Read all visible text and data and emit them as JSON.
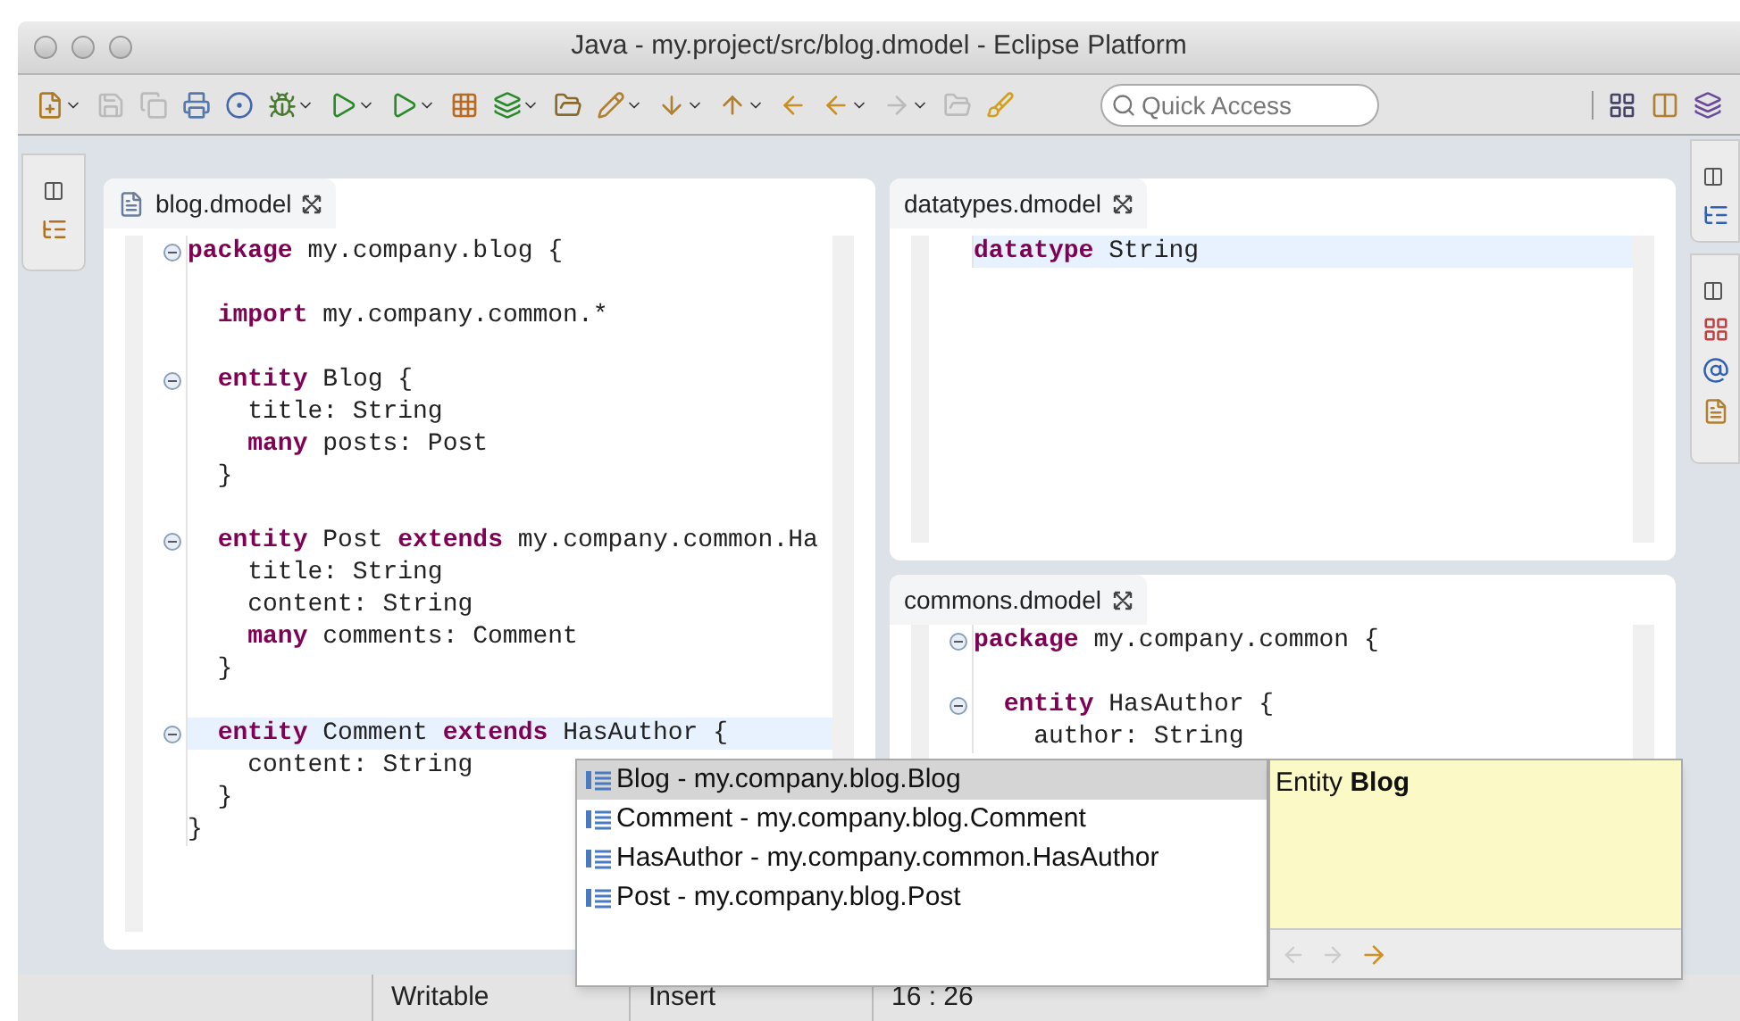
{
  "window": {
    "title": "Java - my.project/src/blog.dmodel - Eclipse Platform"
  },
  "quick_access": {
    "placeholder": "Quick Access"
  },
  "editors": [
    {
      "tab": "blog.dmodel",
      "file_icon": true,
      "lines": [
        {
          "fold": true,
          "highlighted": false,
          "code": "**package** my.company.blog {"
        },
        {
          "fold": false,
          "highlighted": false
        },
        {
          "fold": false,
          "highlighted": false,
          "code": "  **import** my.company.common.*"
        },
        {
          "fold": false,
          "highlighted": false
        },
        {
          "fold": true,
          "highlighted": false,
          "code": "  **entity** Blog {"
        },
        {
          "fold": false,
          "highlighted": false,
          "code": "    title: String"
        },
        {
          "fold": false,
          "highlighted": false,
          "code": "    **many** posts: Post"
        },
        {
          "fold": false,
          "highlighted": false,
          "code": "  }"
        },
        {
          "fold": false,
          "highlighted": false
        },
        {
          "fold": true,
          "highlighted": false,
          "code": "  **entity** Post **extends** my.company.common.Ha"
        },
        {
          "fold": false,
          "highlighted": false,
          "code": "    title: String"
        },
        {
          "fold": false,
          "highlighted": false,
          "code": "    content: String"
        },
        {
          "fold": false,
          "highlighted": false,
          "code": "    **many** comments: Comment"
        },
        {
          "fold": false,
          "highlighted": false,
          "code": "  }"
        },
        {
          "fold": false,
          "highlighted": false
        },
        {
          "fold": true,
          "highlighted": true,
          "code": "  **entity** Comment **extends** HasAuthor {"
        },
        {
          "fold": false,
          "highlighted": false,
          "code": "    content: String"
        },
        {
          "fold": false,
          "highlighted": false,
          "code": "  }"
        },
        {
          "fold": false,
          "highlighted": false,
          "code": "}"
        }
      ]
    },
    {
      "tab": "datatypes.dmodel",
      "file_icon": false,
      "lines": [
        {
          "fold": false,
          "highlighted": true,
          "code": "**datatype** String"
        }
      ]
    },
    {
      "tab": "commons.dmodel",
      "file_icon": false,
      "lines": [
        {
          "fold": true,
          "highlighted": false,
          "code": "**package** my.company.common {"
        },
        {
          "fold": false,
          "highlighted": false
        },
        {
          "fold": true,
          "highlighted": false,
          "code": "  **entity** HasAuthor {"
        },
        {
          "fold": false,
          "highlighted": false,
          "code": "    author: String"
        }
      ]
    }
  ],
  "completion": {
    "items": [
      {
        "label": "Blog - my.company.blog.Blog",
        "selected": true
      },
      {
        "label": "Comment - my.company.blog.Comment",
        "selected": false
      },
      {
        "label": "HasAuthor - my.company.common.HasAuthor",
        "selected": false
      },
      {
        "label": "Post - my.company.blog.Post",
        "selected": false
      }
    ],
    "doc": "Entity **Blog**"
  },
  "status_bar": [
    "Writable",
    "Insert",
    "16 : 26"
  ]
}
